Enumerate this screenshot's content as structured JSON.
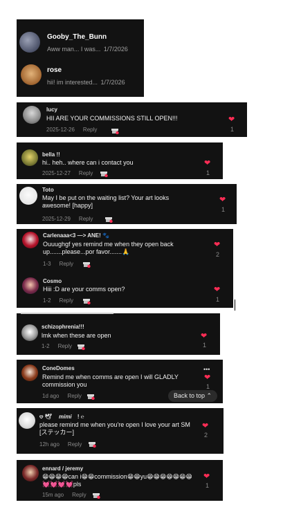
{
  "dm_list": [
    {
      "name": "Gooby_The_Bunn",
      "preview": "Aww man... I was...",
      "date": "1/7/2026"
    },
    {
      "name": "rose",
      "preview": "hii! im interested...",
      "date": "1/7/2026"
    }
  ],
  "comments": {
    "lucy": {
      "user": "lucy",
      "text": "HII ARE YOUR COMMISSIONS STILL OPEN!!!",
      "time": "2025-12-26",
      "reply": "Reply",
      "likes": "1"
    },
    "bella": {
      "user": "bella !!",
      "text": "hi.. heh.. where can i contact you",
      "time": "2025-12-27",
      "reply": "Reply",
      "likes": "1"
    },
    "toto": {
      "user": "Toto",
      "text": "May I be put on the waiting list? Your art looks awesome! [happy]",
      "time": "2025-12-29",
      "reply": "Reply",
      "likes": "1"
    },
    "carlenaaa": {
      "user": "Carlenaaa<3 —> ANE! 🐾",
      "text": "Ouuughgf yes remind me when they open back up.......please...por favor.......🙏",
      "time": "1-3",
      "reply": "Reply",
      "likes": "2"
    },
    "cosmo": {
      "user": "Cosmo",
      "text": "Hiii :D are your comms open?",
      "time": "1-2",
      "reply": "Reply",
      "likes": "1"
    },
    "schizo": {
      "user": "schizophrenia!!!",
      "text": "lmk when these are open",
      "time": "1-2",
      "reply": "Reply",
      "likes": "1"
    },
    "conedomes": {
      "user": "ConeDomes",
      "text": "Remind me when comms are open I will GLADLY commission you",
      "time": "1d ago",
      "reply": "Reply",
      "likes": "1",
      "more": "•••"
    },
    "mimi": {
      "user_prefix": "𖹭 🕊",
      "user": "mimi",
      "user_suffix": "! ℮",
      "text": "please remind me when you're open I love your art SM [ステッカー]",
      "time": "12h ago",
      "reply": "Reply",
      "likes": "2"
    },
    "ennard": {
      "user": "ennard / jeremy",
      "text": "😁😁😁😁can i😁😁commission😁😁yu😁😁😁😁😁😁😁💓💓💓💓pls",
      "time": "15m ago",
      "reply": "Reply",
      "likes": "1"
    }
  },
  "back_to_top": "Back to top ⌃",
  "colors": {
    "heart": "#ff2d55",
    "card_bg": "#121212",
    "meta": "#8a8a8a"
  },
  "icons": {
    "heart": "heart-icon",
    "gift": "gift-icon",
    "more": "more-options-icon"
  }
}
